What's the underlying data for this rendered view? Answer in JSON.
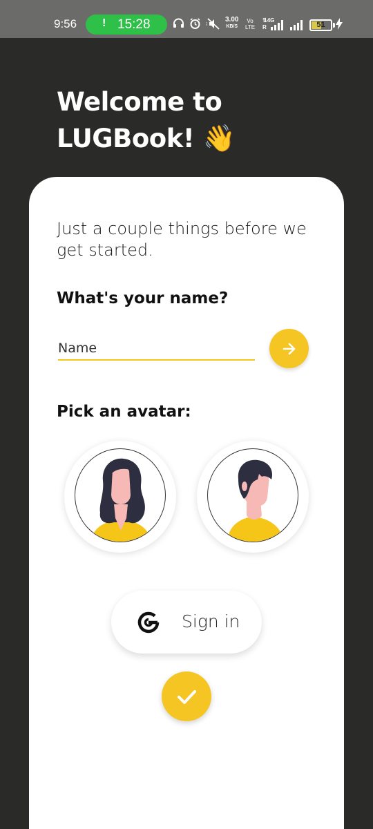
{
  "status_bar": {
    "time": "9:56",
    "call_timer": "15:28",
    "call_icon": "phone-call-icon",
    "network_speed_value": "3.00",
    "network_speed_unit": "KB/S",
    "volte_top": "Vo",
    "volte_bottom": "LTE",
    "network_type": "4G",
    "roaming": "R",
    "battery_level": "51",
    "colors": {
      "background": "#6b6b69",
      "call_pill": "#2fc04a",
      "battery_fill": "#d9c84a"
    }
  },
  "header": {
    "title_line1": "Welcome to",
    "title_line2": "LUGBook!",
    "emoji": "👋"
  },
  "card": {
    "intro": "Just a couple things before we get started.",
    "name_question": "What's your name?",
    "name_input": {
      "placeholder": "Name",
      "value": ""
    },
    "next_icon": "arrow-right-icon",
    "avatar_question": "Pick an avatar:",
    "avatars": [
      {
        "id": "female",
        "icon": "female-avatar-icon"
      },
      {
        "id": "male",
        "icon": "male-avatar-icon"
      }
    ],
    "sign_in_label": "Sign in",
    "sign_in_icon": "google-icon",
    "confirm_icon": "checkmark-icon"
  },
  "colors": {
    "accent": "#f5c524",
    "background": "#2a2a28",
    "card": "#ffffff"
  }
}
